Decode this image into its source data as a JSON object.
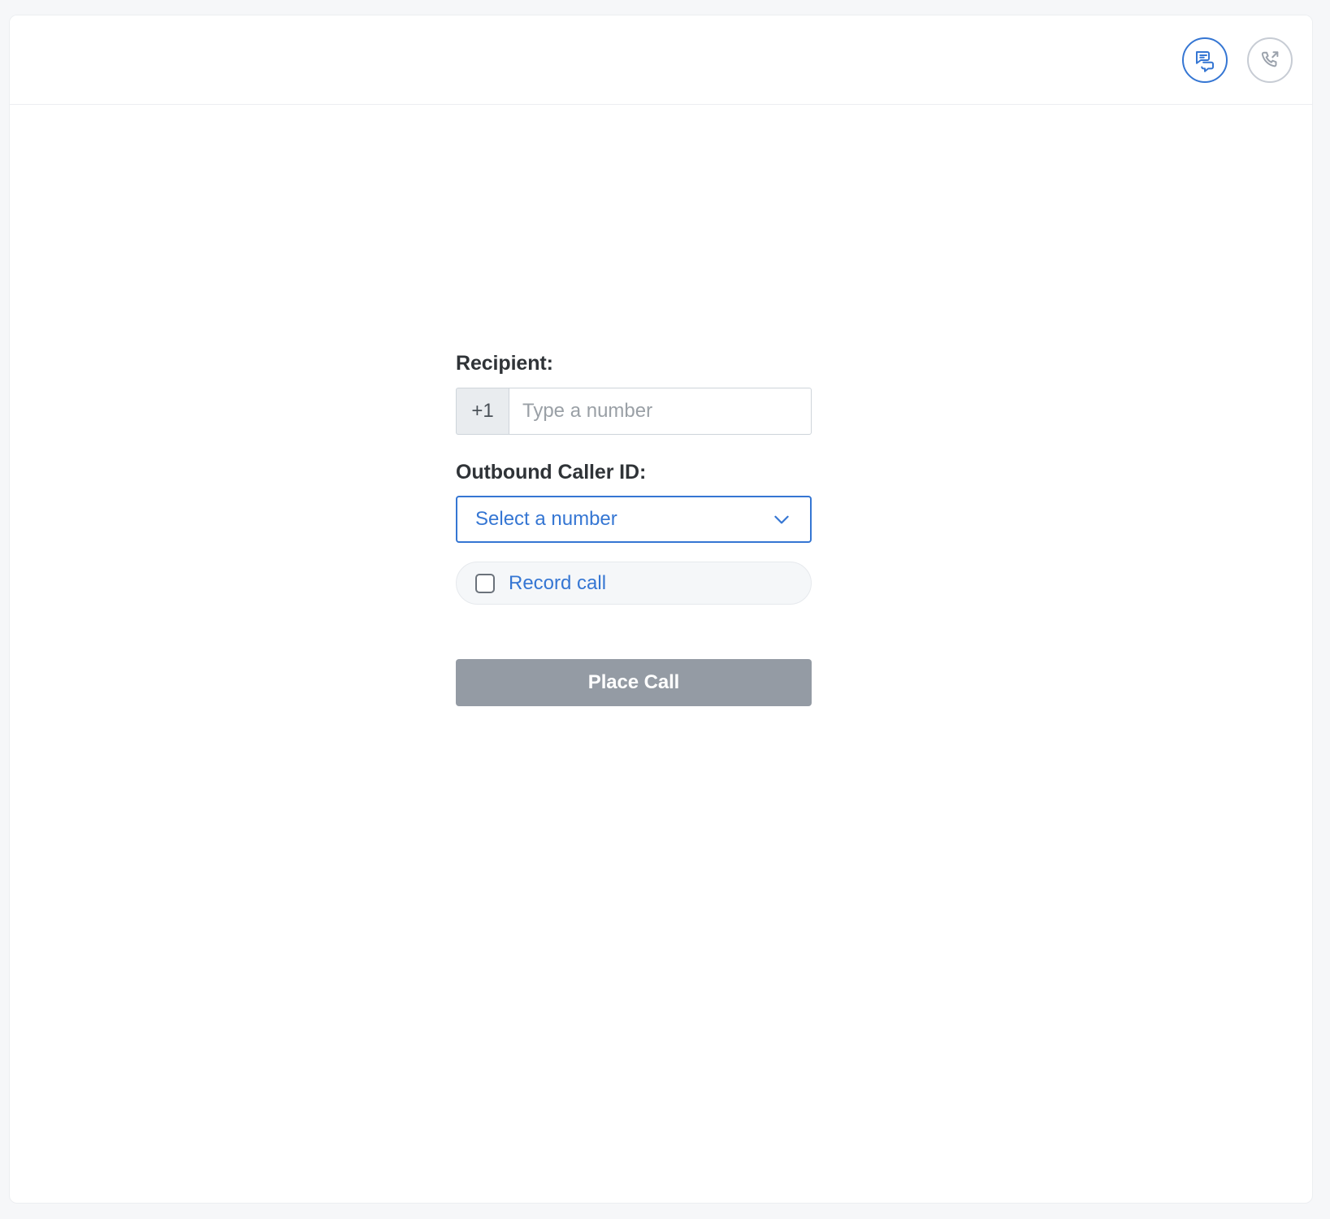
{
  "header": {
    "actions": [
      {
        "name": "messages-icon",
        "title": "Messages"
      },
      {
        "name": "outbound-call-icon",
        "title": "Outbound call"
      }
    ]
  },
  "form": {
    "recipient": {
      "label": "Recipient:",
      "country_prefix": "+1",
      "placeholder": "Type a number",
      "value": ""
    },
    "caller_id": {
      "label": "Outbound Caller ID:",
      "selected": "Select a number",
      "chevron_icon": "chevron-down-icon"
    },
    "record_call": {
      "label": "Record call",
      "checked": false
    },
    "submit": {
      "label": "Place Call",
      "disabled": true
    }
  },
  "colors": {
    "accent": "#3576d3",
    "muted": "#c7ccd4",
    "disabled_button": "#949ba4",
    "page_background": "#f6f7f9",
    "card_background": "#ffffff",
    "border": "#eceef1"
  }
}
